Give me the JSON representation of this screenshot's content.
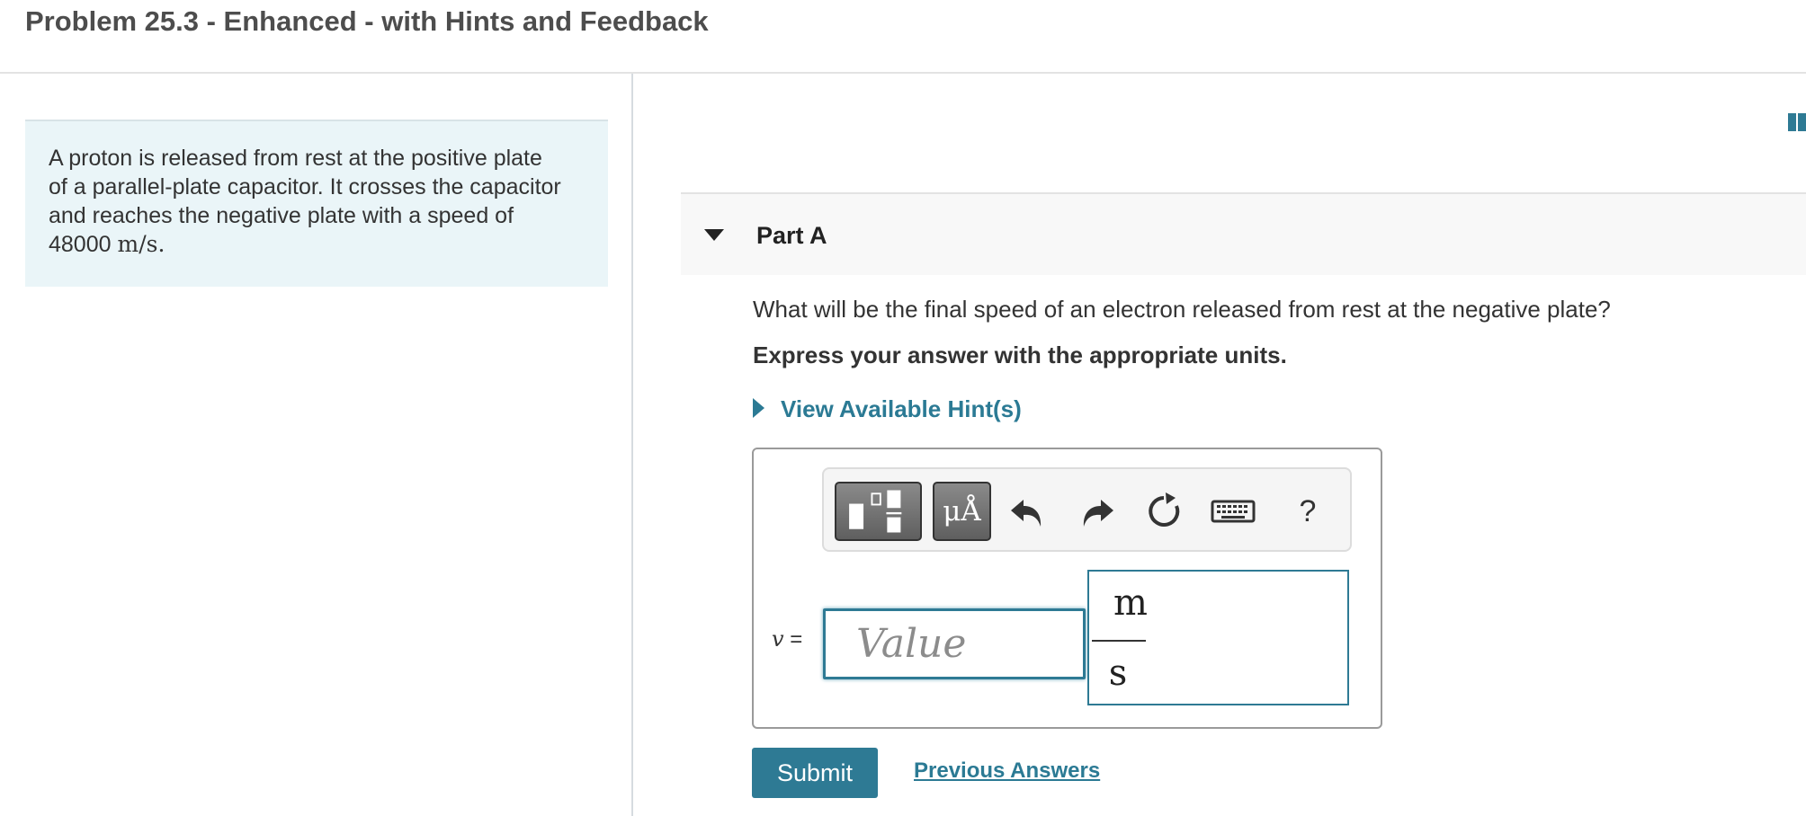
{
  "header": {
    "title": "Problem 25.3 - Enhanced - with Hints and Feedback"
  },
  "intro": {
    "line1": "A proton is released from rest at the positive plate",
    "line2": "of a parallel-plate capacitor. It crosses the capacitor",
    "line3": "and reaches the negative plate with a speed of",
    "speed_value": "48000",
    "speed_unit": "m/s",
    "period": "."
  },
  "part": {
    "label": "Part A",
    "question": "What will be the final speed of an electron released from rest at the negative plate?",
    "instruction": "Express your answer with the appropriate units.",
    "hint_link": "View Available Hint(s)"
  },
  "toolbar": {
    "units_label": "μÅ",
    "help_label": "?",
    "icons": [
      "templates-icon",
      "undo-icon",
      "redo-icon",
      "reset-icon",
      "keyboard-icon"
    ]
  },
  "answer": {
    "variable": "v",
    "equals": "=",
    "value": "",
    "value_placeholder": "Value",
    "unit_numerator": "m",
    "unit_denominator": "s"
  },
  "actions": {
    "submit_label": "Submit",
    "previous_answers_label": "Previous Answers"
  },
  "colors": {
    "accent": "#2e7a94",
    "link": "#2b7a94",
    "intro_background": "#eaf5f8",
    "part_bar_background": "#f8f8f8"
  }
}
